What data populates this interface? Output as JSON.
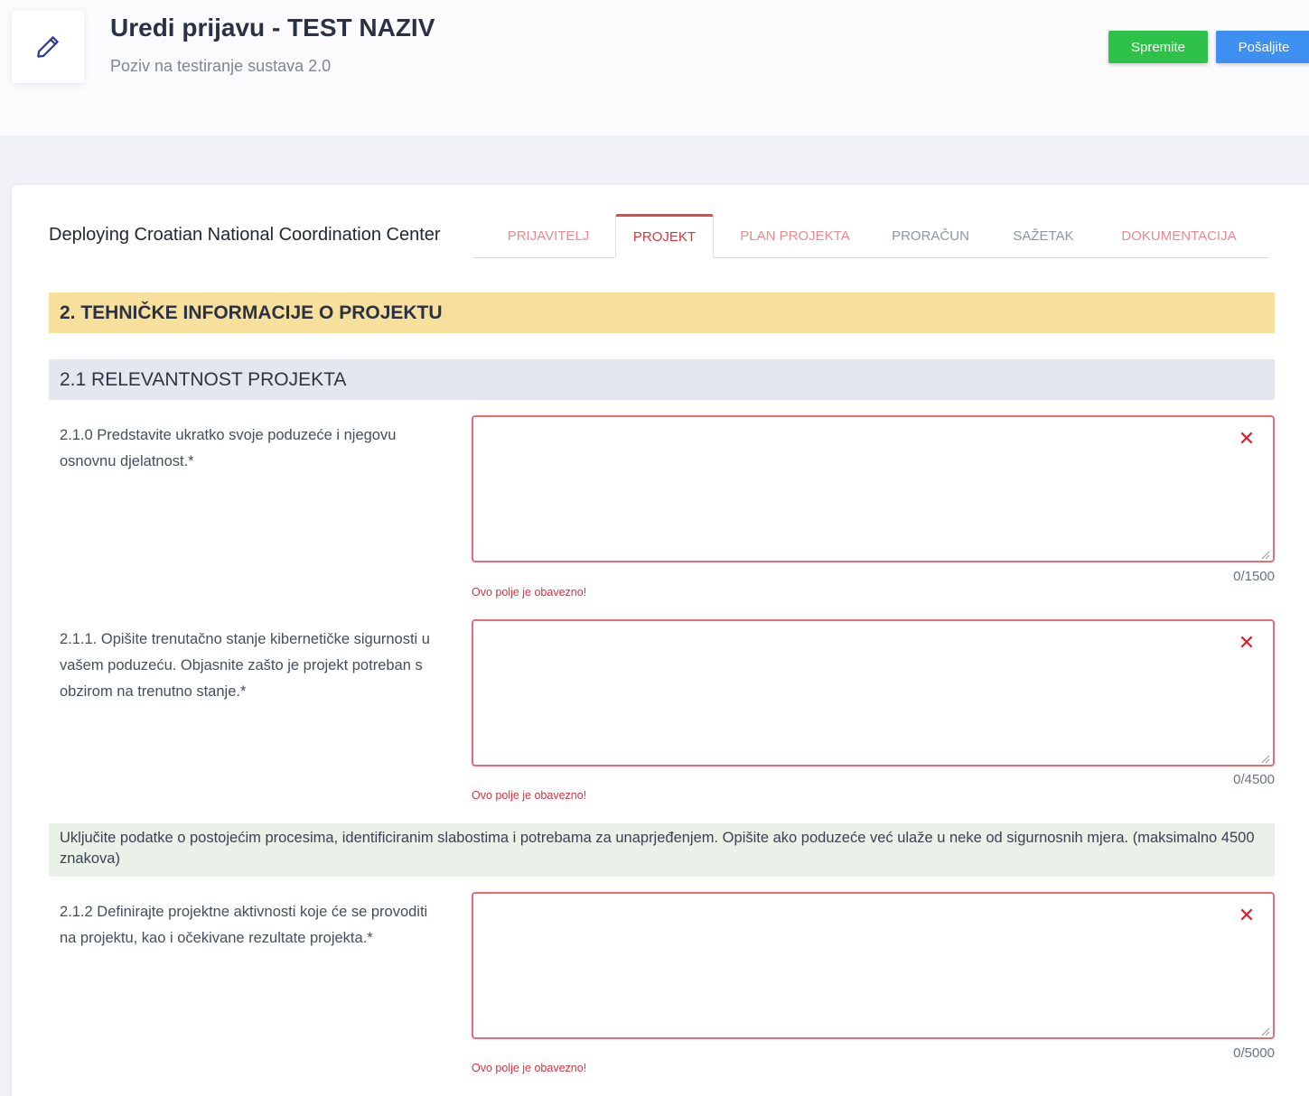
{
  "header": {
    "title": "Uredi prijavu - TEST NAZIV",
    "subtitle": "Poziv na testiranje sustava 2.0",
    "save_label": "Spremite",
    "send_label": "Pošaljite"
  },
  "project": {
    "name": "Deploying Croatian National Coordination Center"
  },
  "tabs": [
    {
      "label": "PRIJAVITELJ"
    },
    {
      "label": "PROJEKT"
    },
    {
      "label": "PLAN PROJEKTA"
    },
    {
      "label": "PRORAČUN"
    },
    {
      "label": "SAŽETAK"
    },
    {
      "label": "DOKUMENTACIJA"
    }
  ],
  "active_tab": "PROJEKT",
  "section": {
    "title": "2. TEHNIČKE INFORMACIJE O PROJEKTU",
    "subsection_title": "2.1 RELEVANTNOST PROJEKTA"
  },
  "questions": [
    {
      "label": "2.1.0 Predstavite ukratko svoje poduzeće i njegovu osnovnu djelatnost.*",
      "value": "",
      "counter": "0/1500",
      "error": "Ovo polje je obavezno!"
    },
    {
      "label": "2.1.1. Opišite trenutačno stanje kibernetičke sigurnosti u vašem poduzeću. Objasnite zašto je projekt potreban s obzirom na trenutno stanje.*",
      "value": "",
      "counter": "0/4500",
      "error": "Ovo polje je obavezno!"
    },
    {
      "label": "2.1.2 Definirajte projektne aktivnosti koje će se provoditi na projektu, kao i očekivane rezultate projekta.*",
      "value": "",
      "counter": "0/5000",
      "error": "Ovo polje je obavezno!"
    }
  ],
  "hint": "Uključite podatke o postojećim procesima, identificiranim slabostima i potrebama za unaprjeđenjem. Opišite ako poduzeće već ulaže u neke od sigurnosnih mjera. (maksimalno 4500 znakova)",
  "colors": {
    "save_button": "#2fc24a",
    "send_button": "#3d8ff0",
    "section_header": "#f6e09c",
    "subsection_header": "#e5e7ef",
    "error": "#e0313d",
    "hint_background": "#e9f1e9",
    "active_tab": "#d8343f"
  },
  "icons": {
    "edit": "pencil-icon",
    "clear": "close-icon"
  }
}
